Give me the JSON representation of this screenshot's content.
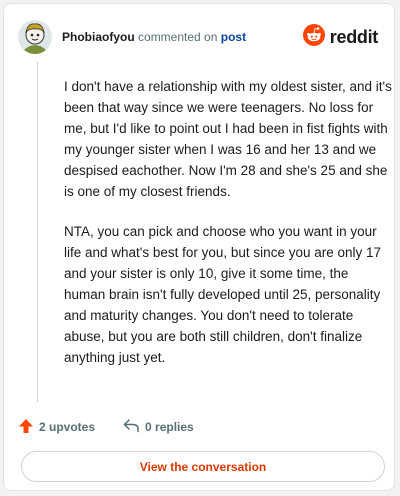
{
  "header": {
    "author": "Phobiaofyou",
    "action_text": "commented on",
    "post_link": "post",
    "brand": "reddit"
  },
  "comment": {
    "paragraphs": [
      "I don't have a relationship with my oldest sister, and it's been that way since we were teenagers. No loss for me, but I'd like to point out I had been in fist fights with my younger sister when I was 16 and her 13 and we despised eachother. Now I'm 28 and she's 25 and she is one of my closest friends.",
      "NTA, you can pick and choose who you want in your life and what's best for you, but since you are only 17 and your sister is only 10, give it some time, the human brain isn't fully developed until 25, personality and maturity changes. You don't need to tolerate abuse, but you are both still children, don't finalize anything just yet."
    ]
  },
  "actions": {
    "upvotes": "2 upvotes",
    "replies": "0 replies"
  },
  "cta": {
    "label": "View the conversation"
  },
  "colors": {
    "brand_orange": "#ff4500",
    "link_blue": "#0a449b",
    "cta_text": "#d93a00",
    "muted": "#576f76"
  },
  "icons": [
    "avatar",
    "reddit-logo-icon",
    "upvote-arrow-icon",
    "reply-icon"
  ]
}
